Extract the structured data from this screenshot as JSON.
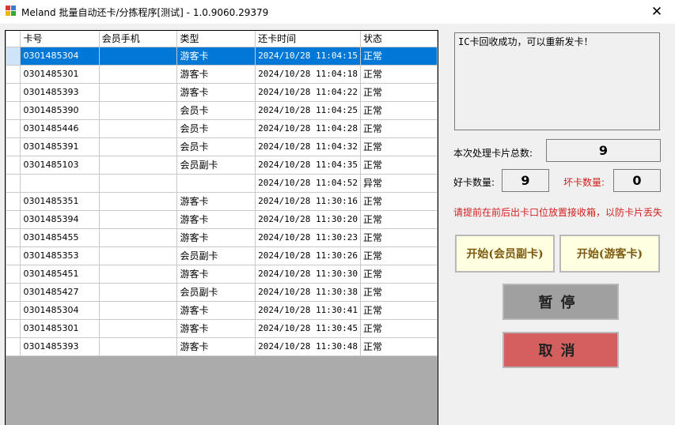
{
  "window": {
    "title": "Meland 批量自动还卡/分拣程序[测试] - 1.0.9060.29379",
    "close_glyph": "✕"
  },
  "grid": {
    "columns": [
      "卡号",
      "会员手机",
      "类型",
      "还卡时间",
      "状态"
    ],
    "rows": [
      [
        "0301485304",
        "",
        "游客卡",
        "2024/10/28 11:04:15",
        "正常"
      ],
      [
        "0301485301",
        "",
        "游客卡",
        "2024/10/28 11:04:18",
        "正常"
      ],
      [
        "0301485393",
        "",
        "游客卡",
        "2024/10/28 11:04:22",
        "正常"
      ],
      [
        "0301485390",
        "",
        "会员卡",
        "2024/10/28 11:04:25",
        "正常"
      ],
      [
        "0301485446",
        "",
        "会员卡",
        "2024/10/28 11:04:28",
        "正常"
      ],
      [
        "0301485391",
        "",
        "会员卡",
        "2024/10/28 11:04:32",
        "正常"
      ],
      [
        "0301485103",
        "",
        "会员副卡",
        "2024/10/28 11:04:35",
        "正常"
      ],
      [
        "",
        "",
        "",
        "2024/10/28 11:04:52",
        "异常"
      ],
      [
        "0301485351",
        "",
        "游客卡",
        "2024/10/28 11:30:16",
        "正常"
      ],
      [
        "0301485394",
        "",
        "游客卡",
        "2024/10/28 11:30:20",
        "正常"
      ],
      [
        "0301485455",
        "",
        "游客卡",
        "2024/10/28 11:30:23",
        "正常"
      ],
      [
        "0301485353",
        "",
        "会员副卡",
        "2024/10/28 11:30:26",
        "正常"
      ],
      [
        "0301485451",
        "",
        "游客卡",
        "2024/10/28 11:30:30",
        "正常"
      ],
      [
        "0301485427",
        "",
        "会员副卡",
        "2024/10/28 11:30:38",
        "正常"
      ],
      [
        "0301485304",
        "",
        "游客卡",
        "2024/10/28 11:30:41",
        "正常"
      ],
      [
        "0301485301",
        "",
        "游客卡",
        "2024/10/28 11:30:45",
        "正常"
      ],
      [
        "0301485393",
        "",
        "游客卡",
        "2024/10/28 11:30:48",
        "正常"
      ]
    ],
    "selected_row": 0
  },
  "panel": {
    "message": "IC卡回收成功，可以重新发卡！",
    "total_label": "本次处理卡片总数:",
    "total_value": "9",
    "good_label": "好卡数量:",
    "good_value": "9",
    "bad_label": "坏卡数量:",
    "bad_value": "0",
    "warning": "请提前在前后出卡口位放置接收箱，以防卡片丢失",
    "start_member_label": "开始(会员副卡)",
    "start_guest_label": "开始(游客卡)",
    "pause_label": "暂停",
    "cancel_label": "取消"
  },
  "colors": {
    "selection": "#0078d7",
    "warning": "#d42020",
    "start_bg": "#ffffe1",
    "pause_bg": "#a0a0a0",
    "cancel_bg": "#d45f5f"
  }
}
